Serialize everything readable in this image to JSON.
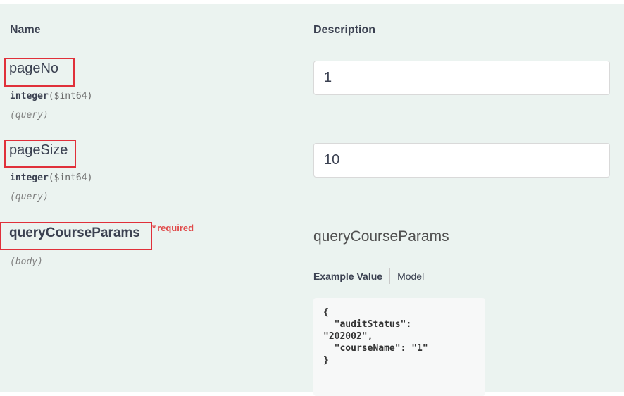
{
  "headers": {
    "name": "Name",
    "description": "Description"
  },
  "params": [
    {
      "name": "pageNo",
      "type": "integer",
      "format": "($int64)",
      "in": "(query)",
      "value": "1"
    },
    {
      "name": "pageSize",
      "type": "integer",
      "format": "($int64)",
      "in": "(query)",
      "value": "10"
    },
    {
      "name": "queryCourseParams",
      "required_label": "required",
      "in": "(body)"
    }
  ],
  "body": {
    "schema_title": "queryCourseParams",
    "tab_example": "Example Value",
    "tab_model": "Model",
    "example_json": "{\n  \"auditStatus\":\n\"202002\",\n  \"courseName\": \"1\"\n}"
  },
  "colors": {
    "panel_bg": "#ebf3f0",
    "highlight": "#e0303a",
    "required": "#e04a4a"
  }
}
